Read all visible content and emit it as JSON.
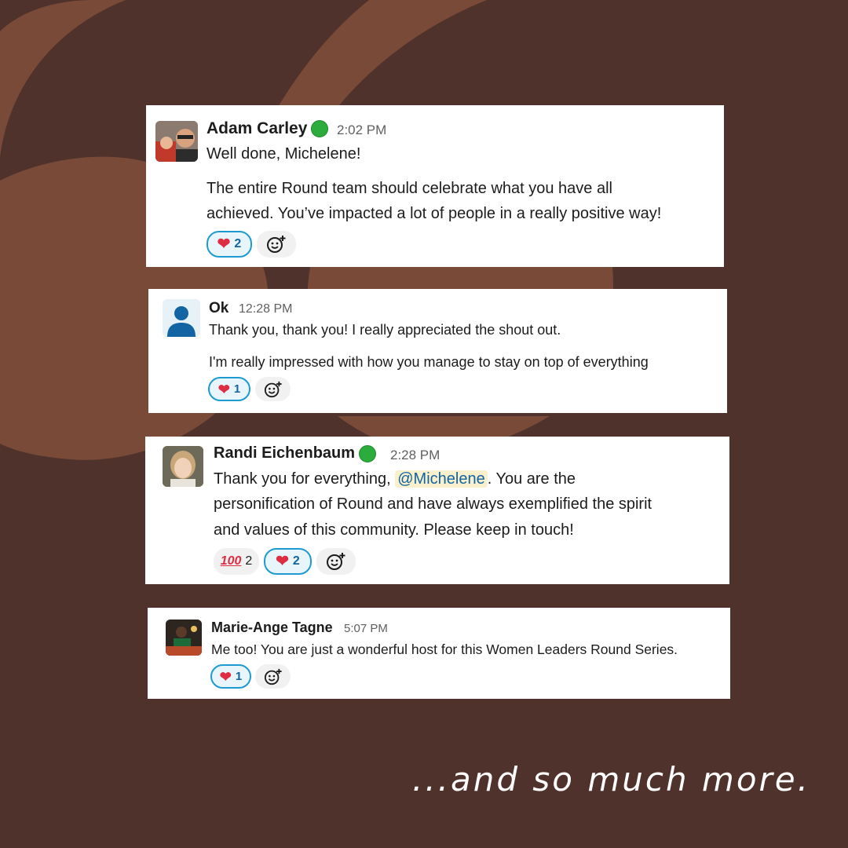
{
  "messages": [
    {
      "author": "Adam Carley",
      "online": true,
      "time": "2:02 PM",
      "lines": [
        "Well done, Michelene!"
      ],
      "paragraph": [
        "The entire Round team should celebrate what you have all",
        "achieved. You’ve impacted a lot of people in a really positive way!"
      ],
      "reactions": [
        {
          "emoji": "heart",
          "count": "2",
          "selected": true
        }
      ]
    },
    {
      "author": "Ok",
      "online": false,
      "time": "12:28 PM",
      "lines": [
        "Thank you, thank you! I really appreciated the shout out."
      ],
      "paragraph": [
        "I'm really impressed with how you manage to stay on top of everything"
      ],
      "reactions": [
        {
          "emoji": "heart",
          "count": "1",
          "selected": true
        }
      ]
    },
    {
      "author": "Randi Eichenbaum",
      "online": true,
      "time": "2:28 PM",
      "line1_before": "Thank you for everything, ",
      "mention": "@Michelene",
      "line1_after": ". You are the",
      "lines": [
        "personification of Round and have always exemplified the spirit",
        "and values of this community. Please keep in touch!"
      ],
      "reactions": [
        {
          "emoji": "100",
          "count": "2",
          "selected": false
        },
        {
          "emoji": "heart",
          "count": "2",
          "selected": true
        }
      ]
    },
    {
      "author": "Marie-Ange Tagne",
      "online": false,
      "time": "5:07 PM",
      "lines": [
        "Me too! You are just a wonderful host for this Women Leaders Round Series."
      ],
      "reactions": [
        {
          "emoji": "heart",
          "count": "1",
          "selected": true
        }
      ]
    }
  ],
  "tagline": "...and so much more.",
  "colors": {
    "background": "#4f322b",
    "decoration": "#7a4a38",
    "online": "#2bac3c",
    "mention_bg": "#fbf0cc",
    "reaction_border": "#1d9bd1"
  }
}
